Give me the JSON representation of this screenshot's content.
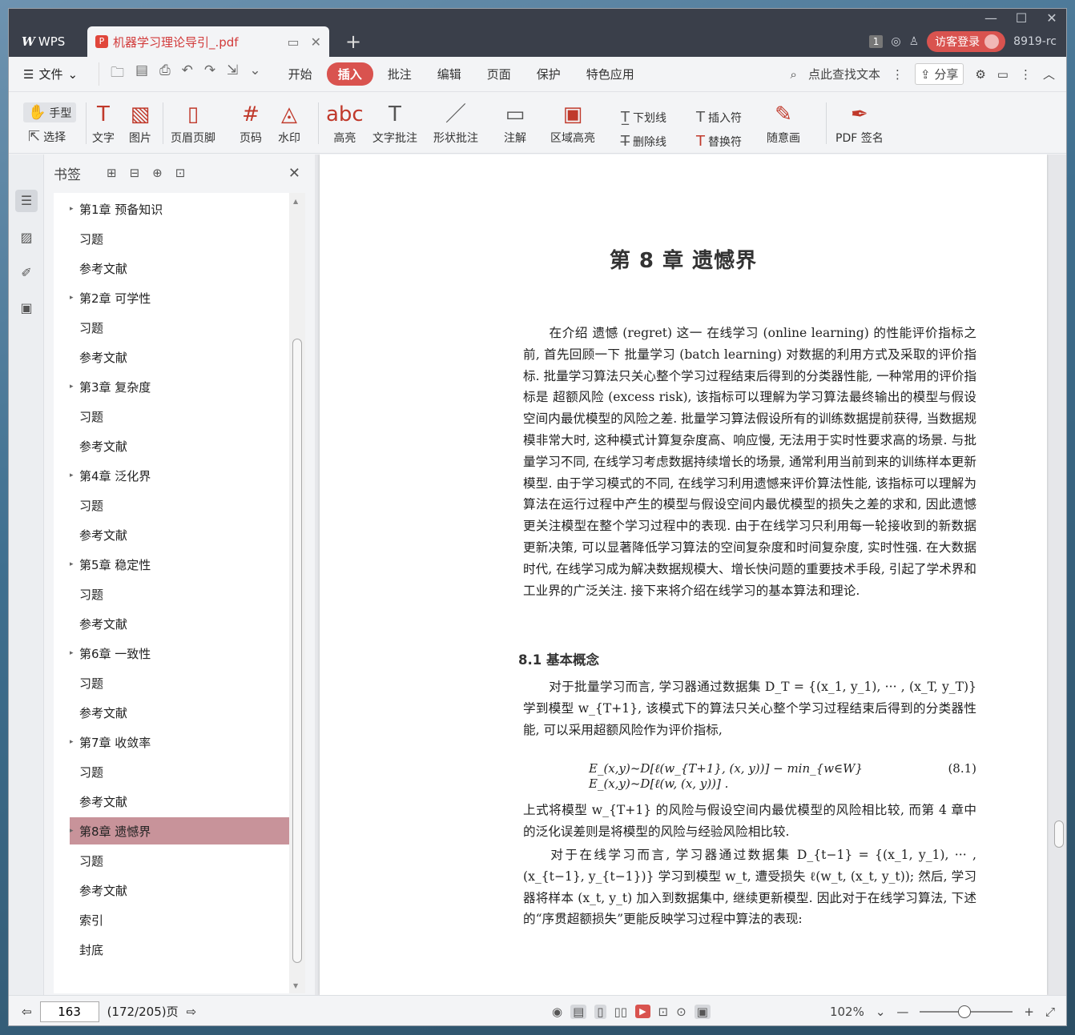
{
  "window": {
    "app_tab": "WPS",
    "doc_tab": "机器学习理论导引_.pdf",
    "notification_count": "1",
    "login_label": "访客登录",
    "user_id": "8919-rc"
  },
  "menubar": {
    "file_label": "文件",
    "tabs": [
      "开始",
      "插入",
      "批注",
      "编辑",
      "页面",
      "保护",
      "特色应用"
    ],
    "active_tab": "插入",
    "search_label": "点此查找文本",
    "share_label": "分享"
  },
  "ribbon": {
    "hand_label": "手型",
    "select_label": "选择",
    "text_label": "文字",
    "image_label": "图片",
    "header_footer_label": "页眉页脚",
    "page_number_label": "页码",
    "watermark_label": "水印",
    "highlight_label": "高亮",
    "text_comment_label": "文字批注",
    "shape_comment_label": "形状批注",
    "annotation_label": "注解",
    "area_highlight_label": "区域高亮",
    "underline_label": "下划线",
    "strikethrough_label": "删除线",
    "insert_mark_label": "插入符",
    "replace_mark_label": "替换符",
    "freehand_label": "随意画",
    "pdf_sign_label": "PDF 签名"
  },
  "bookmarks": {
    "title": "书签",
    "items": [
      {
        "label": "第1章 预备知识",
        "expandable": true
      },
      {
        "label": "习题",
        "expandable": false
      },
      {
        "label": "参考文献",
        "expandable": false
      },
      {
        "label": "第2章 可学性",
        "expandable": true
      },
      {
        "label": "习题",
        "expandable": false
      },
      {
        "label": "参考文献",
        "expandable": false
      },
      {
        "label": "第3章 复杂度",
        "expandable": true
      },
      {
        "label": "习题",
        "expandable": false
      },
      {
        "label": "参考文献",
        "expandable": false
      },
      {
        "label": "第4章 泛化界",
        "expandable": true
      },
      {
        "label": "习题",
        "expandable": false
      },
      {
        "label": "参考文献",
        "expandable": false
      },
      {
        "label": "第5章 稳定性",
        "expandable": true
      },
      {
        "label": "习题",
        "expandable": false
      },
      {
        "label": "参考文献",
        "expandable": false
      },
      {
        "label": "第6章 一致性",
        "expandable": true
      },
      {
        "label": "习题",
        "expandable": false
      },
      {
        "label": "参考文献",
        "expandable": false
      },
      {
        "label": "第7章 收敛率",
        "expandable": true
      },
      {
        "label": "习题",
        "expandable": false
      },
      {
        "label": "参考文献",
        "expandable": false
      },
      {
        "label": "第8章 遗憾界",
        "expandable": true,
        "active": true
      },
      {
        "label": "习题",
        "expandable": false
      },
      {
        "label": "参考文献",
        "expandable": false
      },
      {
        "label": "索引",
        "expandable": false
      },
      {
        "label": "封底",
        "expandable": false
      }
    ]
  },
  "document": {
    "chapter_title": "第 8 章   遗憾界",
    "intro_paragraph": "在介绍 遗憾 (regret) 这一 在线学习 (online learning) 的性能评价指标之前, 首先回顾一下 批量学习 (batch learning) 对数据的利用方式及采取的评价指标. 批量学习算法只关心整个学习过程结束后得到的分类器性能, 一种常用的评价指标是 超额风险 (excess risk), 该指标可以理解为学习算法最终输出的模型与假设空间内最优模型的风险之差. 批量学习算法假设所有的训练数据提前获得, 当数据规模非常大时, 这种模式计算复杂度高、响应慢, 无法用于实时性要求高的场景. 与批量学习不同, 在线学习考虑数据持续增长的场景, 通常利用当前到来的训练样本更新模型. 由于学习模式的不同, 在线学习利用遗憾来评价算法性能, 该指标可以理解为算法在运行过程中产生的模型与假设空间内最优模型的损失之差的求和, 因此遗憾更关注模型在整个学习过程中的表现. 由于在线学习只利用每一轮接收到的新数据更新决策, 可以显著降低学习算法的空间复杂度和时间复杂度, 实时性强. 在大数据时代, 在线学习成为解决数据规模大、增长快问题的重要技术手段, 引起了学术界和工业界的广泛关注. 接下来将介绍在线学习的基本算法和理论.",
    "section_title": "8.1  基本概念",
    "section_paragraph_1": "对于批量学习而言, 学习器通过数据集 D_T = {(x_1, y_1), ··· , (x_T, y_T)} 学到模型 w_{T+1}, 该模式下的算法只关心整个学习过程结束后得到的分类器性能, 可以采用超额风险作为评价指标,",
    "equation": "E_(x,y)~D[ℓ(w_{T+1}, (x, y))] − min_{w∈W} E_(x,y)~D[ℓ(w, (x, y))] .",
    "equation_number": "(8.1)",
    "section_paragraph_2": "上式将模型 w_{T+1} 的风险与假设空间内最优模型的风险相比较, 而第 4 章中的泛化误差则是将模型的风险与经验风险相比较.",
    "section_paragraph_3": "对于在线学习而言, 学习器通过数据集 D_{t−1} = {(x_1, y_1), ··· , (x_{t−1}, y_{t−1})} 学习到模型 w_t, 遭受损失 ℓ(w_t, (x_t, y_t)); 然后, 学习器将样本 (x_t, y_t) 加入到数据集中, 继续更新模型. 因此对于在线学习算法, 下述的“序贯超额损失”更能反映学习过程中算法的表现:"
  },
  "statusbar": {
    "page_input": "163",
    "page_info": "(172/205)页",
    "zoom": "102%"
  },
  "colors": {
    "accent": "#d9534f",
    "bookmark_active": "#c8939a",
    "titlebar": "#3a3f4a"
  }
}
